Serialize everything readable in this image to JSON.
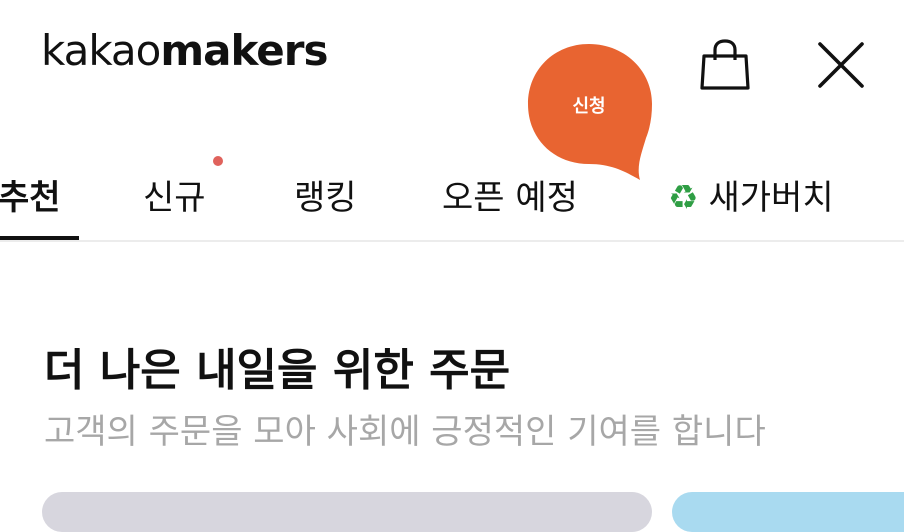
{
  "header": {
    "logo_part1": "kakao",
    "logo_part2": "makers"
  },
  "bubble": {
    "label": "신청",
    "color": "#e86431"
  },
  "tabs": [
    {
      "label": "추천",
      "active": true
    },
    {
      "label": "신규",
      "new_dot": true
    },
    {
      "label": "랭킹"
    },
    {
      "label": "오픈 예정"
    },
    {
      "label": "새가버치",
      "icon": "recycle-icon"
    }
  ],
  "section": {
    "title": "더 나은 내일을 위한 주문",
    "subtitle": "고객의 주문을 모아 사회에 긍정적인 기여를 합니다"
  },
  "colors": {
    "accent_dot": "#e0625c",
    "subtitle": "#a7a7a7"
  }
}
